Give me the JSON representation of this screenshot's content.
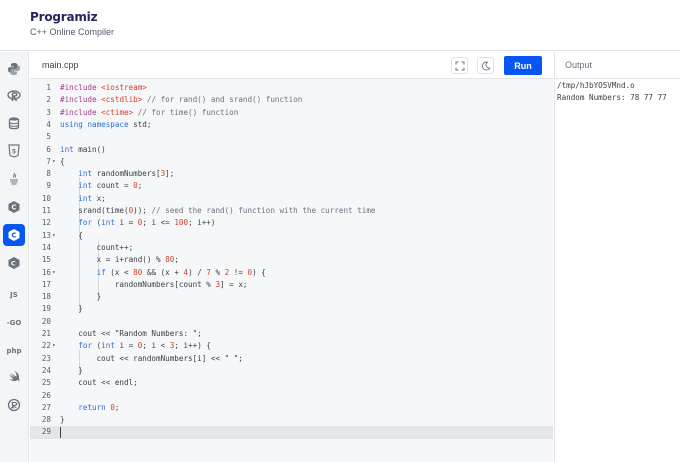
{
  "header": {
    "logo_text": "Programiz",
    "subtitle": "C++ Online Compiler"
  },
  "sidebar": {
    "items": [
      {
        "name": "python-icon",
        "kind": "icon"
      },
      {
        "name": "r-icon",
        "kind": "icon"
      },
      {
        "name": "sql-icon",
        "kind": "icon"
      },
      {
        "name": "html-icon",
        "kind": "icon"
      },
      {
        "name": "java-icon",
        "kind": "icon"
      },
      {
        "name": "c-icon",
        "kind": "icon"
      },
      {
        "name": "cpp-icon",
        "kind": "icon",
        "active": true
      },
      {
        "name": "csharp-icon",
        "kind": "icon"
      },
      {
        "name": "js-icon",
        "kind": "text",
        "label": "JS"
      },
      {
        "name": "go-icon",
        "kind": "text",
        "label": "-GO"
      },
      {
        "name": "php-icon",
        "kind": "text",
        "label": "php"
      },
      {
        "name": "swift-icon",
        "kind": "icon"
      },
      {
        "name": "rust-icon",
        "kind": "icon"
      }
    ],
    "active_color": "#0556f3"
  },
  "editor": {
    "filename": "main.cpp",
    "run_label": "Run",
    "active_line": 29,
    "lines": [
      {
        "n": "1",
        "fold": "",
        "text": "#include <iostream>"
      },
      {
        "n": "2",
        "fold": "",
        "text": "#include <cstdlib> // for rand() and srand() function"
      },
      {
        "n": "3",
        "fold": "",
        "text": "#include <ctime> // for time() function"
      },
      {
        "n": "4",
        "fold": "",
        "text": "using namespace std;"
      },
      {
        "n": "5",
        "fold": "",
        "text": ""
      },
      {
        "n": "6",
        "fold": "",
        "text": "int main()"
      },
      {
        "n": "7",
        "fold": "▾",
        "text": "{"
      },
      {
        "n": "8",
        "fold": "",
        "text": "    int randomNumbers[3];"
      },
      {
        "n": "9",
        "fold": "",
        "text": "    int count = 0;"
      },
      {
        "n": "10",
        "fold": "",
        "text": "    int x;"
      },
      {
        "n": "11",
        "fold": "",
        "text": "    srand(time(0)); // seed the rand() function with the current time"
      },
      {
        "n": "12",
        "fold": "",
        "text": "    for (int i = 0; i <= 100; i++)"
      },
      {
        "n": "13",
        "fold": "▾",
        "text": "    {"
      },
      {
        "n": "14",
        "fold": "",
        "text": "        count++;"
      },
      {
        "n": "15",
        "fold": "",
        "text": "        x = i+rand() % 80;"
      },
      {
        "n": "16",
        "fold": "▾",
        "text": "        if (x < 80 && (x + 4) / 7 % 2 != 0) {"
      },
      {
        "n": "17",
        "fold": "",
        "text": "            randomNumbers[count % 3] = x;"
      },
      {
        "n": "18",
        "fold": "",
        "text": "        }"
      },
      {
        "n": "19",
        "fold": "",
        "text": "    }"
      },
      {
        "n": "20",
        "fold": "",
        "text": ""
      },
      {
        "n": "21",
        "fold": "",
        "text": "    cout << \"Random Numbers: \";"
      },
      {
        "n": "22",
        "fold": "▾",
        "text": "    for (int i = 0; i < 3; i++) {"
      },
      {
        "n": "23",
        "fold": "",
        "text": "        cout << randomNumbers[i] << \" \";"
      },
      {
        "n": "24",
        "fold": "",
        "text": "    }"
      },
      {
        "n": "25",
        "fold": "",
        "text": "    cout << endl;"
      },
      {
        "n": "26",
        "fold": "",
        "text": ""
      },
      {
        "n": "27",
        "fold": "",
        "text": "    return 0;"
      },
      {
        "n": "28",
        "fold": "",
        "text": "}"
      },
      {
        "n": "29",
        "fold": "",
        "text": ""
      }
    ]
  },
  "output": {
    "title": "Output",
    "lines": [
      "/tmp/hJbYO5VMnd.o",
      "Random Numbers: 78 77 77"
    ]
  }
}
